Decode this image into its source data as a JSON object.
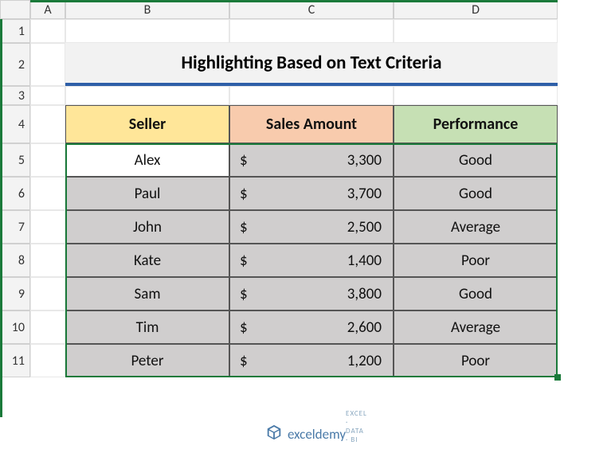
{
  "columns": [
    "A",
    "B",
    "C",
    "D"
  ],
  "row_numbers": [
    1,
    2,
    3,
    4,
    5,
    6,
    7,
    8,
    9,
    10,
    11
  ],
  "title": "Highlighting Based on Text Criteria",
  "headers": {
    "seller": "Seller",
    "amount": "Sales Amount",
    "performance": "Performance"
  },
  "currency_symbol": "$",
  "rows": [
    {
      "seller": "Alex",
      "amount": "3,300",
      "performance": "Good",
      "active": true
    },
    {
      "seller": "Paul",
      "amount": "3,700",
      "performance": "Good",
      "active": false
    },
    {
      "seller": "John",
      "amount": "2,500",
      "performance": "Average",
      "active": false
    },
    {
      "seller": "Kate",
      "amount": "1,400",
      "performance": "Poor",
      "active": false
    },
    {
      "seller": "Sam",
      "amount": "3,800",
      "performance": "Good",
      "active": false
    },
    {
      "seller": "Tim",
      "amount": "2,600",
      "performance": "Average",
      "active": false
    },
    {
      "seller": "Peter",
      "amount": "1,200",
      "performance": "Poor",
      "active": false
    }
  ],
  "watermark": {
    "brand": "exceldemy",
    "tagline": "EXCEL · DATA · BI"
  },
  "chart_data": {
    "type": "table",
    "title": "Highlighting Based on Text Criteria",
    "columns": [
      "Seller",
      "Sales Amount",
      "Performance"
    ],
    "data": [
      [
        "Alex",
        3300,
        "Good"
      ],
      [
        "Paul",
        3700,
        "Good"
      ],
      [
        "John",
        2500,
        "Average"
      ],
      [
        "Kate",
        1400,
        "Poor"
      ],
      [
        "Sam",
        3800,
        "Good"
      ],
      [
        "Tim",
        2600,
        "Average"
      ],
      [
        "Peter",
        1200,
        "Poor"
      ]
    ]
  }
}
